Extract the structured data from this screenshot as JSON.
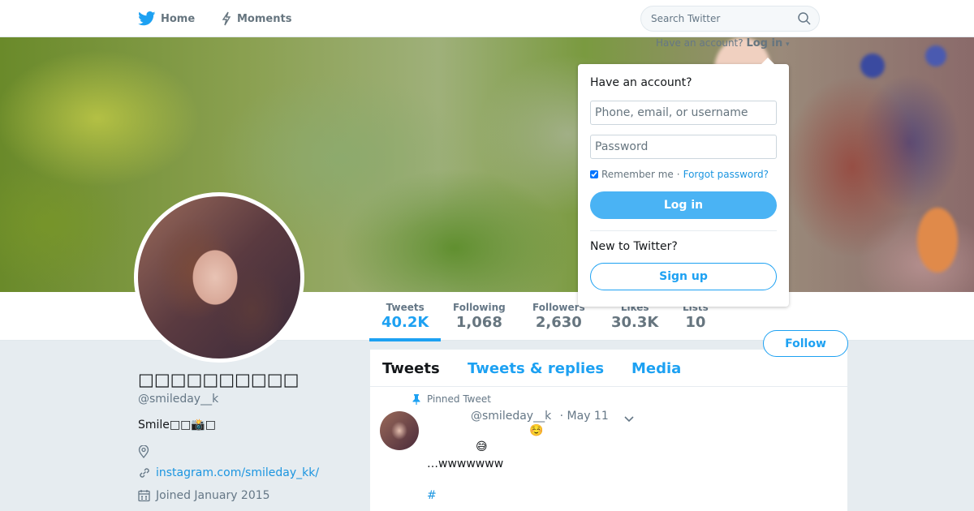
{
  "nav": {
    "home_label": "Home",
    "moments_label": "Moments",
    "search_placeholder": "Search Twitter"
  },
  "login_teaser": {
    "prefix": "Have an account?",
    "login_label": "Log in"
  },
  "login_dropdown": {
    "title": "Have an account?",
    "username_placeholder": "Phone, email, or username",
    "password_placeholder": "Password",
    "remember_label": "Remember me",
    "separator": "·",
    "forgot_label": "Forgot password?",
    "login_button": "Log in",
    "new_label": "New to Twitter?",
    "signup_button": "Sign up"
  },
  "stats": [
    {
      "label": "Tweets",
      "value": "40.2K",
      "active": true
    },
    {
      "label": "Following",
      "value": "1,068"
    },
    {
      "label": "Followers",
      "value": "2,630"
    },
    {
      "label": "Likes",
      "value": "30.3K"
    },
    {
      "label": "Lists",
      "value": "10"
    }
  ],
  "follow_button": "Follow",
  "profile": {
    "name": "□□□□□□□□□□",
    "handle": "@smileday__k",
    "bio": "Smile□□📸□",
    "link": "instagram.com/smileday_kk/",
    "joined": "Joined January 2015"
  },
  "timeline": {
    "tabs": [
      "Tweets",
      "Tweets & replies",
      "Media"
    ],
    "pinned_label": "Pinned Tweet",
    "tweet": {
      "handle": "@smileday__k",
      "date": "· May 11",
      "emoji1": "☺️",
      "emoji2": "😅",
      "text": "…wwwwwww",
      "hashtag": "#"
    }
  },
  "colors": {
    "accent": "#1da1f2",
    "link": "#1b95e0",
    "background": "#e6ecf0"
  }
}
